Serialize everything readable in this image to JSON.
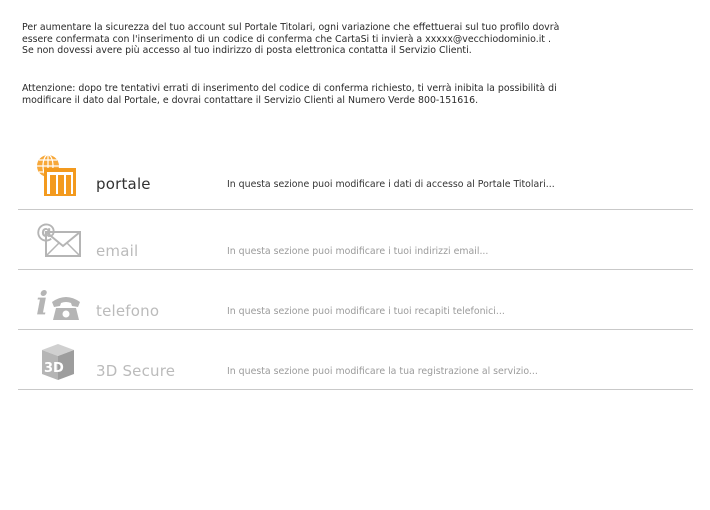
{
  "intro": {
    "line1": "Per aumentare la sicurezza del tuo account sul Portale Titolari, ogni variazione che effettuerai sul tuo profilo dovrà",
    "line2": "essere confermata con l'inserimento di un codice di conferma che CartaSi ti invierà a xxxxx@vecchiodominio.it .",
    "line3": "Se non dovessi avere più accesso al tuo indirizzo di posta elettronica contatta il Servizio Clienti."
  },
  "warning": {
    "line1": "Attenzione: dopo tre tentativi errati di inserimento del codice di conferma richiesto, ti verrà inibita la possibilità di",
    "line2": "modificare il dato dal Portale, e dovrai contattare il Servizio Clienti al Numero Verde 800-151616."
  },
  "sections": [
    {
      "title": "portale",
      "description": "In questa sezione puoi modificare i dati di accesso al Portale Titolari...",
      "icon": "portal-building-icon",
      "state": "active",
      "color": "#f39a1e"
    },
    {
      "title": "email",
      "description": "In questa sezione puoi modificare i tuoi indirizzi email...",
      "icon": "email-envelope-icon",
      "state": "inactive",
      "color": "#b5b5b5"
    },
    {
      "title": "telefono",
      "description": "In questa sezione puoi modificare i tuoi recapiti telefonici...",
      "icon": "telephone-icon",
      "state": "inactive",
      "color": "#b5b5b5"
    },
    {
      "title": "3D Secure",
      "description": "In questa sezione puoi modificare la tua registrazione al servizio...",
      "icon": "3d-cube-icon",
      "state": "inactive",
      "color": "#b5b5b5"
    }
  ]
}
